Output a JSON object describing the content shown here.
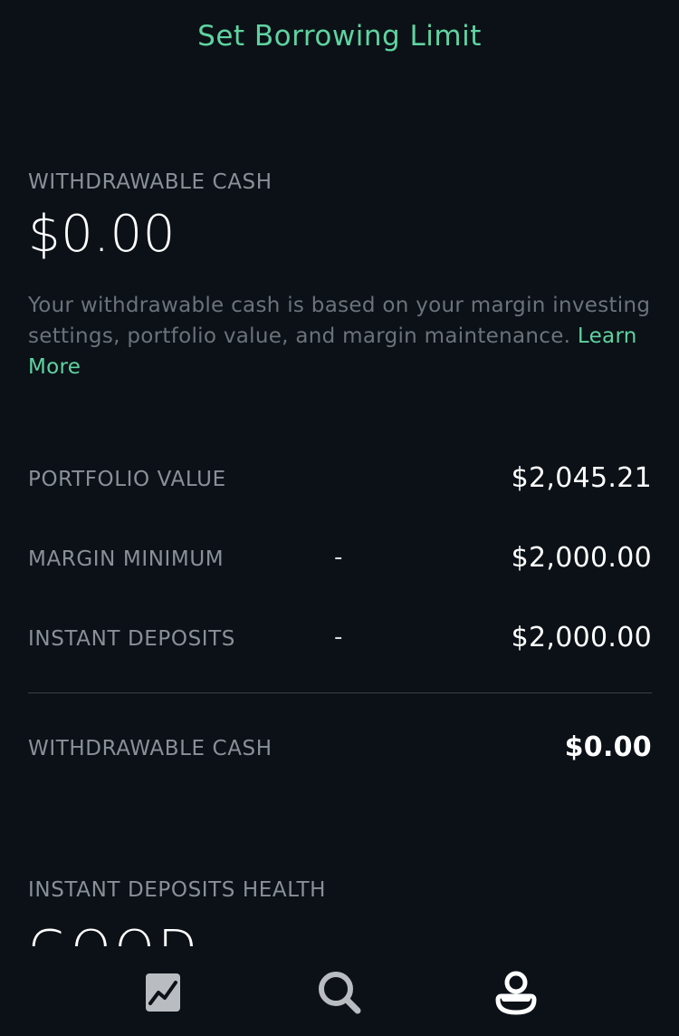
{
  "header": {
    "link_label": "Set Borrowing Limit"
  },
  "withdrawable": {
    "label": "WITHDRAWABLE CASH",
    "amount": "$0.00",
    "description": "Your withdrawable cash is based on your margin investing settings, portfolio value, and margin maintenance. ",
    "learn_more": "Learn More"
  },
  "breakdown": {
    "rows": [
      {
        "label": "PORTFOLIO VALUE",
        "operator": "",
        "value": "$2,045.21"
      },
      {
        "label": "MARGIN MINIMUM",
        "operator": "-",
        "value": "$2,000.00"
      },
      {
        "label": "INSTANT DEPOSITS",
        "operator": "-",
        "value": "$2,000.00"
      }
    ],
    "total": {
      "label": "WITHDRAWABLE CASH",
      "value": "$0.00"
    }
  },
  "health": {
    "label": "INSTANT DEPOSITS HEALTH",
    "value": "GOOD"
  },
  "tabbar": {
    "tabs": [
      {
        "icon": "chart-icon",
        "active": false
      },
      {
        "icon": "search-icon",
        "active": false
      },
      {
        "icon": "account-icon",
        "active": true
      }
    ]
  },
  "colors": {
    "background": "#0b1117",
    "accent": "#5fd3a0",
    "label": "#8a9097",
    "text": "#ffffff"
  }
}
